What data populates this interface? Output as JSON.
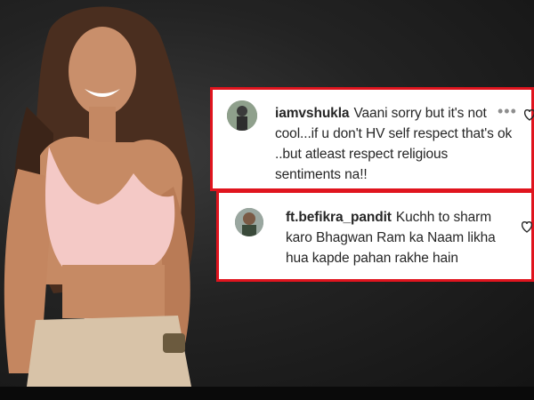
{
  "comments": [
    {
      "username": "iamvshukla",
      "text": "Vaani sorry but it's not cool...if u don't HV self respect that's ok ..but atleast respect religious sentiments na!!",
      "more_icon": "more-dots-icon",
      "like_icon": "heart-outline-icon"
    },
    {
      "username": "ft.befikra_pandit",
      "text": "Kuchh to sharm karo Bhagwan Ram ka Naam likha hua kapde pahan rakhe hain",
      "like_icon": "heart-outline-icon"
    }
  ],
  "colors": {
    "highlight_border": "#e0141e",
    "background": "#1a1a1a",
    "top_color": "#f4c9c6",
    "pants_color": "#d8c3a8"
  }
}
